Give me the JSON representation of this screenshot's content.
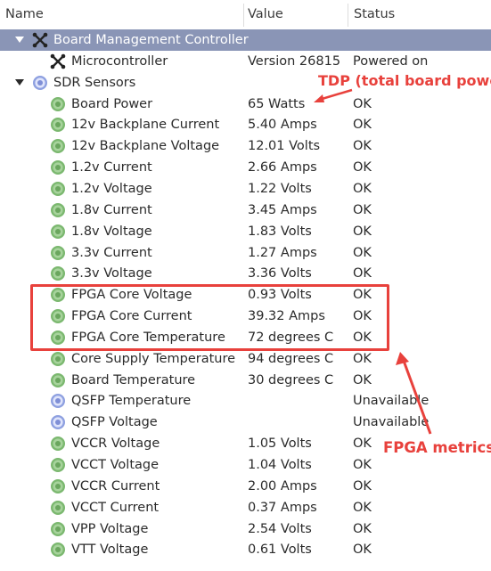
{
  "columns": {
    "name": "Name",
    "value": "Value",
    "status": "Status"
  },
  "rows": [
    {
      "label": "Board Management Controller",
      "value": "",
      "status": "",
      "icon": "network-icon",
      "expanded": true,
      "selected": true,
      "indent": 0
    },
    {
      "label": "Microcontroller",
      "value": "Version 26815",
      "status": "Powered on",
      "icon": "network-icon",
      "indent": 1
    },
    {
      "label": "SDR Sensors",
      "value": "",
      "status": "",
      "icon": "sensor-blue-icon",
      "expanded": true,
      "indent": 0
    },
    {
      "label": "Board Power",
      "value": "65 Watts",
      "status": "OK",
      "icon": "sensor-green-icon",
      "indent": 1
    },
    {
      "label": "12v Backplane Current",
      "value": "5.40 Amps",
      "status": "OK",
      "icon": "sensor-green-icon",
      "indent": 1
    },
    {
      "label": "12v Backplane Voltage",
      "value": "12.01 Volts",
      "status": "OK",
      "icon": "sensor-green-icon",
      "indent": 1
    },
    {
      "label": "1.2v Current",
      "value": "2.66 Amps",
      "status": "OK",
      "icon": "sensor-green-icon",
      "indent": 1
    },
    {
      "label": "1.2v Voltage",
      "value": "1.22 Volts",
      "status": "OK",
      "icon": "sensor-green-icon",
      "indent": 1
    },
    {
      "label": "1.8v Current",
      "value": "3.45 Amps",
      "status": "OK",
      "icon": "sensor-green-icon",
      "indent": 1
    },
    {
      "label": "1.8v Voltage",
      "value": "1.83 Volts",
      "status": "OK",
      "icon": "sensor-green-icon",
      "indent": 1
    },
    {
      "label": "3.3v Current",
      "value": "1.27 Amps",
      "status": "OK",
      "icon": "sensor-green-icon",
      "indent": 1
    },
    {
      "label": "3.3v Voltage",
      "value": "3.36 Volts",
      "status": "OK",
      "icon": "sensor-green-icon",
      "indent": 1
    },
    {
      "label": "FPGA Core Voltage",
      "value": "0.93 Volts",
      "status": "OK",
      "icon": "sensor-green-icon",
      "indent": 1
    },
    {
      "label": "FPGA Core Current",
      "value": "39.32 Amps",
      "status": "OK",
      "icon": "sensor-green-icon",
      "indent": 1
    },
    {
      "label": "FPGA Core Temperature",
      "value": "72 degrees C",
      "status": "OK",
      "icon": "sensor-green-icon",
      "indent": 1
    },
    {
      "label": "Core Supply Temperature",
      "value": "94 degrees C",
      "status": "OK",
      "icon": "sensor-green-icon",
      "indent": 1
    },
    {
      "label": "Board Temperature",
      "value": "30 degrees C",
      "status": "OK",
      "icon": "sensor-green-icon",
      "indent": 1
    },
    {
      "label": "QSFP Temperature",
      "value": "",
      "status": "Unavailable",
      "icon": "sensor-blue-icon",
      "indent": 1
    },
    {
      "label": "QSFP Voltage",
      "value": "",
      "status": "Unavailable",
      "icon": "sensor-blue-icon",
      "indent": 1
    },
    {
      "label": "VCCR Voltage",
      "value": "1.05 Volts",
      "status": "OK",
      "icon": "sensor-green-icon",
      "indent": 1
    },
    {
      "label": "VCCT Voltage",
      "value": "1.04 Volts",
      "status": "OK",
      "icon": "sensor-green-icon",
      "indent": 1
    },
    {
      "label": "VCCR Current",
      "value": "2.00 Amps",
      "status": "OK",
      "icon": "sensor-green-icon",
      "indent": 1
    },
    {
      "label": "VCCT Current",
      "value": "0.37 Amps",
      "status": "OK",
      "icon": "sensor-green-icon",
      "indent": 1
    },
    {
      "label": "VPP Voltage",
      "value": "2.54 Volts",
      "status": "OK",
      "icon": "sensor-green-icon",
      "indent": 1
    },
    {
      "label": "VTT Voltage",
      "value": "0.61 Volts",
      "status": "OK",
      "icon": "sensor-green-icon",
      "indent": 1
    }
  ],
  "annotations": {
    "tdp": "TDP (total board power)",
    "fpga": "FPGA metrics",
    "color": "#e8413c"
  },
  "colors": {
    "selected_row": "#8a95b6",
    "sensor_green": "#7bb86f",
    "sensor_blue": "#8ea0e0"
  }
}
